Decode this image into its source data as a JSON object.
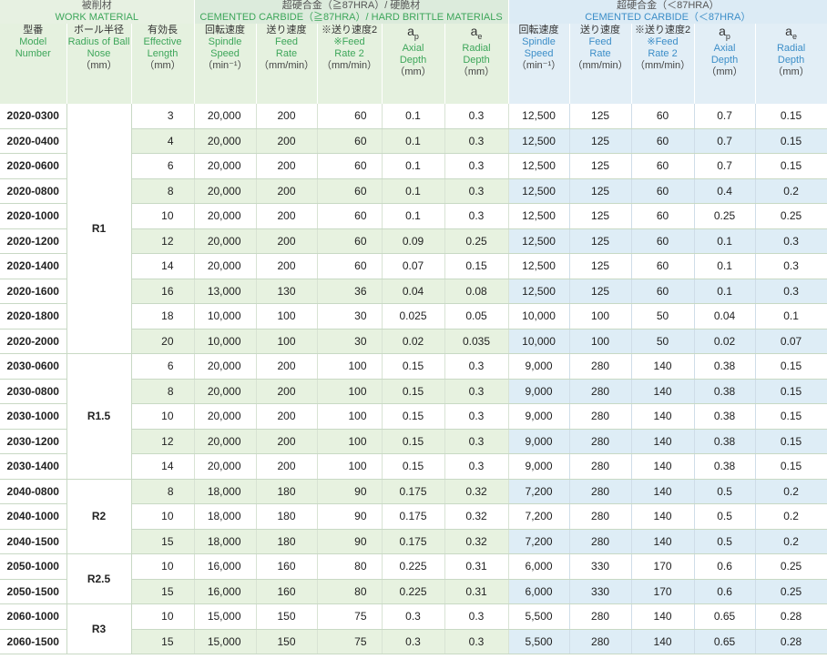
{
  "header": {
    "work_material_jp": "被削材",
    "work_material_en": "WORK MATERIAL",
    "group1_jp": "超硬合金（≧87HRA）/ 硬脆材",
    "group1_en": "CEMENTED CARBIDE（≧87HRA）/ HARD BRITTLE MATERIALS",
    "group2_jp": "超硬合金（＜87HRA）",
    "group2_en": "CEMENTED CARBIDE（＜87HRA）"
  },
  "columns": {
    "model": {
      "jp": "型番",
      "en1": "Model",
      "en2": "Number"
    },
    "radius": {
      "jp": "ボール半径",
      "en1": "Radius of Ball",
      "en2": "Nose",
      "unit": "（mm）"
    },
    "length": {
      "jp": "有効長",
      "en1": "Effective",
      "en2": "Length",
      "unit": "（mm）"
    },
    "speed": {
      "jp": "回転速度",
      "en1": "Spindle",
      "en2": "Speed",
      "unit": "（min⁻¹）"
    },
    "feed": {
      "jp": "送り速度",
      "en1": "Feed",
      "en2": "Rate",
      "unit": "（mm/min）"
    },
    "feed2": {
      "jp": "※送り速度2",
      "en1": "※Feed",
      "en2": "Rate 2",
      "unit": "（mm/min）"
    },
    "ap": {
      "sym": "a",
      "sub": "p",
      "en1": "Axial",
      "en2": "Depth",
      "unit": "（mm）"
    },
    "ae": {
      "sym": "a",
      "sub": "e",
      "en1": "Radial",
      "en2": "Depth",
      "unit": "（mm）"
    }
  },
  "groups": [
    {
      "radius": "R1",
      "rows": [
        {
          "model": "2020-0300",
          "len": "3",
          "s1": "20,000",
          "f1": "200",
          "f2": "60",
          "ap1": "0.1",
          "ae1": "0.3",
          "s2": "12,500",
          "f3": "125",
          "f4": "60",
          "ap2": "0.7",
          "ae2": "0.15"
        },
        {
          "model": "2020-0400",
          "len": "4",
          "s1": "20,000",
          "f1": "200",
          "f2": "60",
          "ap1": "0.1",
          "ae1": "0.3",
          "s2": "12,500",
          "f3": "125",
          "f4": "60",
          "ap2": "0.7",
          "ae2": "0.15"
        },
        {
          "model": "2020-0600",
          "len": "6",
          "s1": "20,000",
          "f1": "200",
          "f2": "60",
          "ap1": "0.1",
          "ae1": "0.3",
          "s2": "12,500",
          "f3": "125",
          "f4": "60",
          "ap2": "0.7",
          "ae2": "0.15"
        },
        {
          "model": "2020-0800",
          "len": "8",
          "s1": "20,000",
          "f1": "200",
          "f2": "60",
          "ap1": "0.1",
          "ae1": "0.3",
          "s2": "12,500",
          "f3": "125",
          "f4": "60",
          "ap2": "0.4",
          "ae2": "0.2"
        },
        {
          "model": "2020-1000",
          "len": "10",
          "s1": "20,000",
          "f1": "200",
          "f2": "60",
          "ap1": "0.1",
          "ae1": "0.3",
          "s2": "12,500",
          "f3": "125",
          "f4": "60",
          "ap2": "0.25",
          "ae2": "0.25"
        },
        {
          "model": "2020-1200",
          "len": "12",
          "s1": "20,000",
          "f1": "200",
          "f2": "60",
          "ap1": "0.09",
          "ae1": "0.25",
          "s2": "12,500",
          "f3": "125",
          "f4": "60",
          "ap2": "0.1",
          "ae2": "0.3"
        },
        {
          "model": "2020-1400",
          "len": "14",
          "s1": "20,000",
          "f1": "200",
          "f2": "60",
          "ap1": "0.07",
          "ae1": "0.15",
          "s2": "12,500",
          "f3": "125",
          "f4": "60",
          "ap2": "0.1",
          "ae2": "0.3"
        },
        {
          "model": "2020-1600",
          "len": "16",
          "s1": "13,000",
          "f1": "130",
          "f2": "36",
          "ap1": "0.04",
          "ae1": "0.08",
          "s2": "12,500",
          "f3": "125",
          "f4": "60",
          "ap2": "0.1",
          "ae2": "0.3"
        },
        {
          "model": "2020-1800",
          "len": "18",
          "s1": "10,000",
          "f1": "100",
          "f2": "30",
          "ap1": "0.025",
          "ae1": "0.05",
          "s2": "10,000",
          "f3": "100",
          "f4": "50",
          "ap2": "0.04",
          "ae2": "0.1"
        },
        {
          "model": "2020-2000",
          "len": "20",
          "s1": "10,000",
          "f1": "100",
          "f2": "30",
          "ap1": "0.02",
          "ae1": "0.035",
          "s2": "10,000",
          "f3": "100",
          "f4": "50",
          "ap2": "0.02",
          "ae2": "0.07"
        }
      ]
    },
    {
      "radius": "R1.5",
      "rows": [
        {
          "model": "2030-0600",
          "len": "6",
          "s1": "20,000",
          "f1": "200",
          "f2": "100",
          "ap1": "0.15",
          "ae1": "0.3",
          "s2": "9,000",
          "f3": "280",
          "f4": "140",
          "ap2": "0.38",
          "ae2": "0.15"
        },
        {
          "model": "2030-0800",
          "len": "8",
          "s1": "20,000",
          "f1": "200",
          "f2": "100",
          "ap1": "0.15",
          "ae1": "0.3",
          "s2": "9,000",
          "f3": "280",
          "f4": "140",
          "ap2": "0.38",
          "ae2": "0.15"
        },
        {
          "model": "2030-1000",
          "len": "10",
          "s1": "20,000",
          "f1": "200",
          "f2": "100",
          "ap1": "0.15",
          "ae1": "0.3",
          "s2": "9,000",
          "f3": "280",
          "f4": "140",
          "ap2": "0.38",
          "ae2": "0.15"
        },
        {
          "model": "2030-1200",
          "len": "12",
          "s1": "20,000",
          "f1": "200",
          "f2": "100",
          "ap1": "0.15",
          "ae1": "0.3",
          "s2": "9,000",
          "f3": "280",
          "f4": "140",
          "ap2": "0.38",
          "ae2": "0.15"
        },
        {
          "model": "2030-1400",
          "len": "14",
          "s1": "20,000",
          "f1": "200",
          "f2": "100",
          "ap1": "0.15",
          "ae1": "0.3",
          "s2": "9,000",
          "f3": "280",
          "f4": "140",
          "ap2": "0.38",
          "ae2": "0.15"
        }
      ]
    },
    {
      "radius": "R2",
      "rows": [
        {
          "model": "2040-0800",
          "len": "8",
          "s1": "18,000",
          "f1": "180",
          "f2": "90",
          "ap1": "0.175",
          "ae1": "0.32",
          "s2": "7,200",
          "f3": "280",
          "f4": "140",
          "ap2": "0.5",
          "ae2": "0.2"
        },
        {
          "model": "2040-1000",
          "len": "10",
          "s1": "18,000",
          "f1": "180",
          "f2": "90",
          "ap1": "0.175",
          "ae1": "0.32",
          "s2": "7,200",
          "f3": "280",
          "f4": "140",
          "ap2": "0.5",
          "ae2": "0.2"
        },
        {
          "model": "2040-1500",
          "len": "15",
          "s1": "18,000",
          "f1": "180",
          "f2": "90",
          "ap1": "0.175",
          "ae1": "0.32",
          "s2": "7,200",
          "f3": "280",
          "f4": "140",
          "ap2": "0.5",
          "ae2": "0.2"
        }
      ]
    },
    {
      "radius": "R2.5",
      "rows": [
        {
          "model": "2050-1000",
          "len": "10",
          "s1": "16,000",
          "f1": "160",
          "f2": "80",
          "ap1": "0.225",
          "ae1": "0.31",
          "s2": "6,000",
          "f3": "330",
          "f4": "170",
          "ap2": "0.6",
          "ae2": "0.25"
        },
        {
          "model": "2050-1500",
          "len": "15",
          "s1": "16,000",
          "f1": "160",
          "f2": "80",
          "ap1": "0.225",
          "ae1": "0.31",
          "s2": "6,000",
          "f3": "330",
          "f4": "170",
          "ap2": "0.6",
          "ae2": "0.25"
        }
      ]
    },
    {
      "radius": "R3",
      "rows": [
        {
          "model": "2060-1000",
          "len": "10",
          "s1": "15,000",
          "f1": "150",
          "f2": "75",
          "ap1": "0.3",
          "ae1": "0.3",
          "s2": "5,500",
          "f3": "280",
          "f4": "140",
          "ap2": "0.65",
          "ae2": "0.28"
        },
        {
          "model": "2060-1500",
          "len": "15",
          "s1": "15,000",
          "f1": "150",
          "f2": "75",
          "ap1": "0.3",
          "ae1": "0.3",
          "s2": "5,500",
          "f3": "280",
          "f4": "140",
          "ap2": "0.65",
          "ae2": "0.28"
        }
      ]
    }
  ]
}
